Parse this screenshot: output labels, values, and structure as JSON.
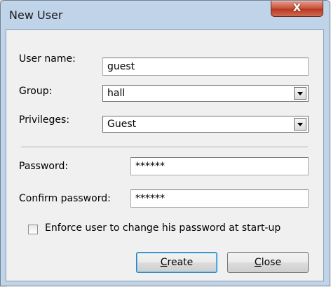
{
  "window": {
    "title": "New User",
    "close_glyph": "X"
  },
  "form": {
    "username": {
      "label": "User name:",
      "value": "guest"
    },
    "group": {
      "label": "Group:",
      "value": "hall"
    },
    "privileges": {
      "label": "Privileges:",
      "value": "Guest"
    },
    "password": {
      "label": "Password:",
      "value": "******"
    },
    "confirm_password": {
      "label": "Confirm password:",
      "value": "******"
    },
    "enforce_change": {
      "label": "Enforce user to change his password at start-up",
      "checked": false
    }
  },
  "buttons": {
    "create": {
      "accel": "C",
      "rest": "reate"
    },
    "close": {
      "accel": "C",
      "rest": "lose"
    }
  },
  "colors": {
    "title_bar": "#bfd3e9",
    "close_button": "#c9503a",
    "dialog_bg": "#f0f0f0"
  }
}
